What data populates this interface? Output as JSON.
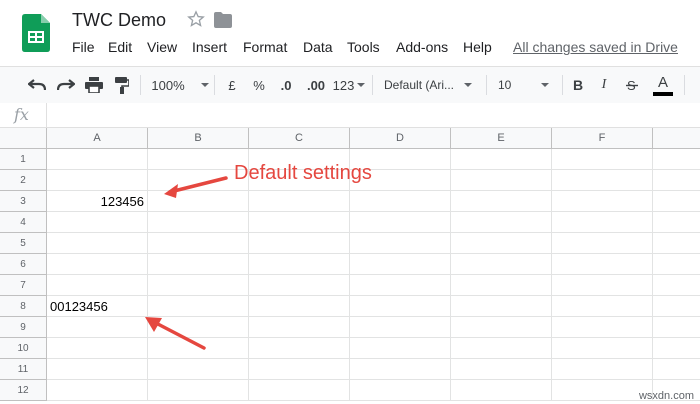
{
  "doc": {
    "title": "TWC Demo",
    "saved_status": "All changes saved in Drive"
  },
  "menu": [
    "File",
    "Edit",
    "View",
    "Insert",
    "Format",
    "Data",
    "Tools",
    "Add-ons",
    "Help"
  ],
  "toolbar": {
    "zoom": "100%",
    "currency": "£",
    "percent": "%",
    "decrease_decimal": ".0",
    "increase_decimal": ".00",
    "more_formats": "123",
    "font": "Default (Ari...",
    "font_size": "10",
    "bold": "B",
    "italic": "I",
    "text_color": "A"
  },
  "formula_bar": {
    "fx_label": "fx",
    "value": ""
  },
  "columns": [
    "A",
    "B",
    "C",
    "D",
    "E",
    "F"
  ],
  "rows": [
    "1",
    "2",
    "3",
    "4",
    "5",
    "6",
    "7",
    "8",
    "9",
    "10",
    "11",
    "12"
  ],
  "cells": {
    "A3": "123456",
    "A8": "00123456"
  },
  "annotation": {
    "text": "Default settings",
    "color": "#e5473f"
  },
  "watermark": "wsxdn.com"
}
